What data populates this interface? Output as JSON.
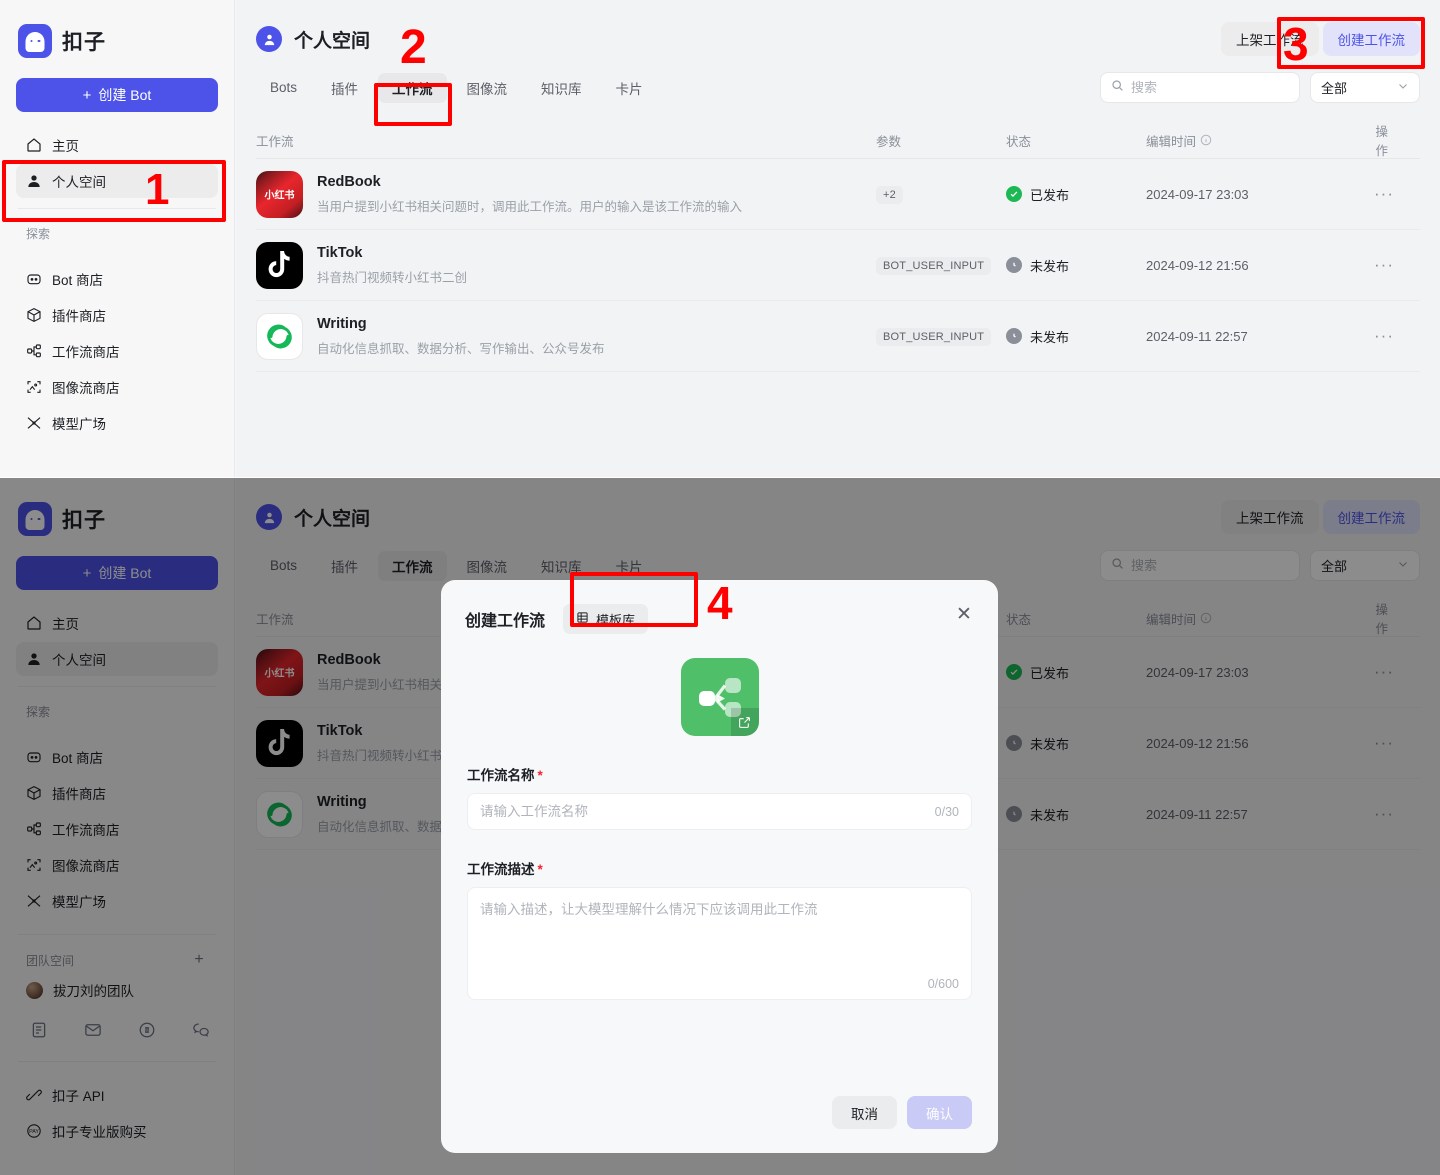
{
  "sidebar": {
    "brand": "扣子",
    "create_bot": "创建 Bot",
    "plus": "+",
    "nav_primary": [
      {
        "label": "主页",
        "icon": "home-icon",
        "active": false
      },
      {
        "label": "个人空间",
        "icon": "user-icon",
        "active": true
      }
    ],
    "explore_label": "探索",
    "nav_explore": [
      {
        "label": "Bot 商店",
        "icon": "bot-store-icon"
      },
      {
        "label": "插件商店",
        "icon": "plugin-store-icon"
      },
      {
        "label": "工作流商店",
        "icon": "workflow-store-icon"
      },
      {
        "label": "图像流商店",
        "icon": "imageflow-store-icon"
      },
      {
        "label": "模型广场",
        "icon": "model-plaza-icon"
      }
    ],
    "team_label": "团队空间",
    "team_add": "+",
    "team_items": [
      {
        "label": "拔刀刘的团队",
        "icon": "team-avatar"
      }
    ],
    "social_icons": [
      "doc-icon",
      "mail-icon",
      "feedback-icon",
      "wechat-icon"
    ],
    "bottom_items": [
      {
        "label": "扣子 API",
        "icon": "api-icon"
      },
      {
        "label": "扣子专业版购买",
        "icon": "pay-icon"
      }
    ]
  },
  "header": {
    "space_name": "个人空间",
    "publish_workflow": "上架工作流",
    "create_workflow": "创建工作流"
  },
  "tabs": [
    {
      "label": "Bots",
      "active": false
    },
    {
      "label": "插件",
      "active": false
    },
    {
      "label": "工作流",
      "active": true
    },
    {
      "label": "图像流",
      "active": false
    },
    {
      "label": "知识库",
      "active": false
    },
    {
      "label": "卡片",
      "active": false
    }
  ],
  "search": {
    "placeholder": "搜索",
    "value": ""
  },
  "filter": {
    "selected": "全部"
  },
  "table": {
    "columns": {
      "workflow": "工作流",
      "params": "参数",
      "status": "状态",
      "edit_time": "编辑时间",
      "ops": "操作"
    },
    "rows": [
      {
        "icon": "redbook-icon",
        "icon_text": "小红书",
        "name": "RedBook",
        "desc": "当用户提到小红书相关问题时，调用此工作流。用户的输入是该工作流的输入",
        "param": "+2",
        "status": "已发布",
        "status_type": "published",
        "time": "2024-09-17 23:03",
        "ops": "···"
      },
      {
        "icon": "tiktok-icon",
        "icon_text": "",
        "name": "TikTok",
        "desc": "抖音热门视频转小红书二创",
        "param": "BOT_USER_INPUT",
        "status": "未发布",
        "status_type": "unpublished",
        "time": "2024-09-12 21:56",
        "ops": "···"
      },
      {
        "icon": "writing-icon",
        "icon_text": "",
        "name": "Writing",
        "desc": "自动化信息抓取、数据分析、写作输出、公众号发布",
        "param": "BOT_USER_INPUT",
        "status": "未发布",
        "status_type": "unpublished",
        "time": "2024-09-11 22:57",
        "ops": "···"
      }
    ]
  },
  "modal": {
    "title": "创建工作流",
    "template_btn": "模板库",
    "close": "✕",
    "name_label": "工作流名称",
    "name_placeholder": "请输入工作流名称",
    "name_counter": "0/30",
    "desc_label": "工作流描述",
    "desc_placeholder": "请输入描述，让大模型理解什么情况下应该调用此工作流",
    "desc_counter": "0/600",
    "cancel": "取消",
    "confirm": "确认",
    "required_mark": "*"
  },
  "annotations": [
    {
      "number": "1"
    },
    {
      "number": "2"
    },
    {
      "number": "3"
    },
    {
      "number": "4"
    }
  ],
  "colors": {
    "brand": "#4d53e8",
    "accent_soft": "#e2e3fb",
    "published": "#1cb854",
    "unpublished": "#8a8f99",
    "annotation": "#ff0000",
    "workflow_green": "#4fbf6a"
  }
}
